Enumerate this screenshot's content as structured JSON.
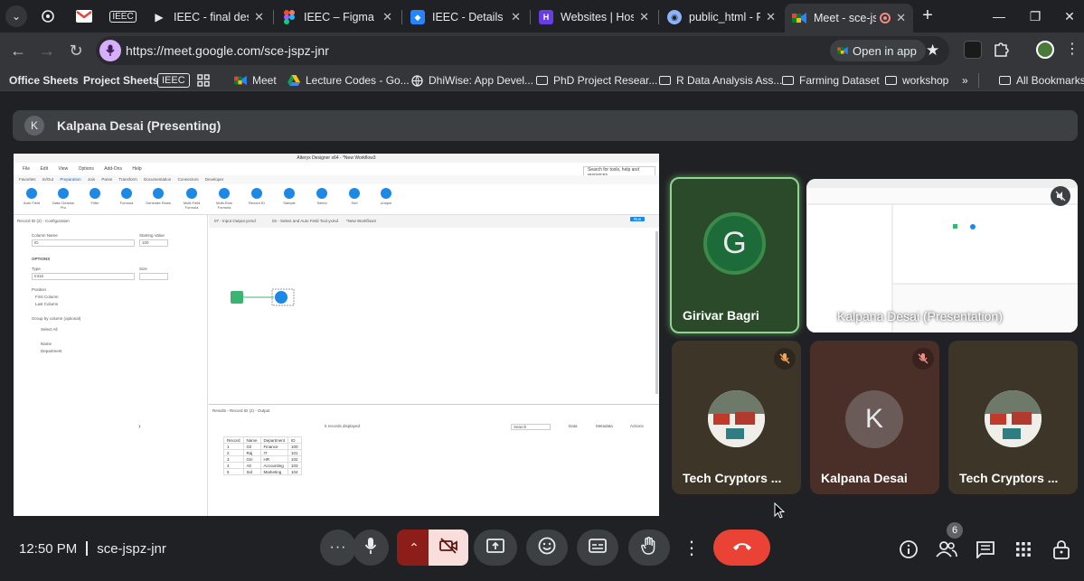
{
  "browser": {
    "tabs": [
      {
        "label": "IEEC - final desig",
        "favicon": "youtube-icon"
      },
      {
        "label": "IEEC – Figma",
        "favicon": "figma-icon"
      },
      {
        "label": "IEEC - Details - Ji",
        "favicon": "jira-icon"
      },
      {
        "label": "Websites | Hostin",
        "favicon": "hostinger-icon"
      },
      {
        "label": "public_html - File",
        "favicon": "file-manager-icon"
      },
      {
        "label": "Meet - sce-js",
        "favicon": "meet-icon",
        "active": true
      }
    ],
    "pinned_iec_label": "IEEC",
    "url": "https://meet.google.com/sce-jspz-jnr",
    "open_in_app_label": "Open in app"
  },
  "bookmarks": [
    {
      "label": "Office Sheets",
      "bold": true
    },
    {
      "label": "Project Sheets",
      "bold": true
    },
    {
      "label": "IEEC",
      "boxed": true
    },
    {
      "label": "Meet"
    },
    {
      "label": "Lecture Codes - Go..."
    },
    {
      "label": "DhiWise: App Devel..."
    },
    {
      "label": "PhD Project Resear..."
    },
    {
      "label": "R Data Analysis Ass..."
    },
    {
      "label": "Farming Dataset"
    },
    {
      "label": "workshop"
    },
    {
      "label": "All Bookmarks"
    }
  ],
  "meet": {
    "presenter_initial": "K",
    "presenter_banner": "Kalpana Desai (Presenting)",
    "presentation_tile_label": "Kalpana Desai (Presentation)",
    "participants": [
      {
        "name": "Girivar Bagri",
        "initial": "G",
        "speaking": true
      },
      {
        "name": "Tech Cryptors ...",
        "muted": true,
        "avatar": "photo"
      },
      {
        "name": "Kalpana Desai",
        "initial": "K",
        "muted": true
      },
      {
        "name": "Tech Cryptors ...",
        "avatar": "photo"
      }
    ],
    "time": "12:50 PM",
    "meeting_code": "sce-jspz-jnr",
    "people_count": "6",
    "colors": {
      "end_call": "#ea4335",
      "camera_off": "#f9dedc",
      "speaking_border": "#8ab4f8"
    }
  },
  "shared_screen": {
    "window_title": "Alteryx Designer x64 - *New Workflow3",
    "menu": [
      "File",
      "Edit",
      "View",
      "Options",
      "Add-Ons",
      "Help"
    ],
    "search_placeholder": "Search for tools, help and resources",
    "categories": [
      "Favorites",
      "In/Out",
      "Preparation",
      "Join",
      "Parse",
      "Transform",
      "Documentation",
      "Connectors",
      "Developer"
    ],
    "tools": [
      "Auto Field",
      "Data Cleanse Pro",
      "Filter",
      "Formula",
      "Generate Rows",
      "Multi-Field Formula",
      "Multi-Row Formula",
      "Record ID",
      "Sample",
      "Select",
      "Sort",
      "Unique"
    ],
    "config_title": "Record ID (2) - Configuration",
    "field_label": "Column Name",
    "field_value": "ID",
    "start_label": "Starting Value",
    "start_value": "100",
    "options_label": "OPTIONS",
    "type_label": "Type",
    "type_value": "Int16",
    "size_label": "Size",
    "position_label": "Position",
    "first_col": "First Column",
    "last_col": "Last Column",
    "group_label": "Group by column (optional)",
    "select_all": "Select All",
    "group_fields": [
      "Name",
      "Department"
    ],
    "canvas_tabs": [
      "07 - Input Output.yxmd",
      "02 - Select and Auto Field Tool.yxmd",
      "*New Workflow3"
    ],
    "run_label": "Run",
    "results_title": "Results - Record ID (2) - Output",
    "records_text": "5 records displayed",
    "search_label": "Search",
    "data_label": "Data",
    "metadata_label": "Metadata",
    "actions_label": "Actions",
    "table_headers": [
      "Record",
      "Name",
      "Department",
      "ID"
    ],
    "table_rows": [
      [
        "1",
        "Gil",
        "Finance",
        "100"
      ],
      [
        "2",
        "Raj",
        "IT",
        "101"
      ],
      [
        "3",
        "Giri",
        "HR",
        "102"
      ],
      [
        "4",
        "Alt",
        "Accounting",
        "103"
      ],
      [
        "5",
        "Sid",
        "Marketing",
        "104"
      ]
    ]
  }
}
